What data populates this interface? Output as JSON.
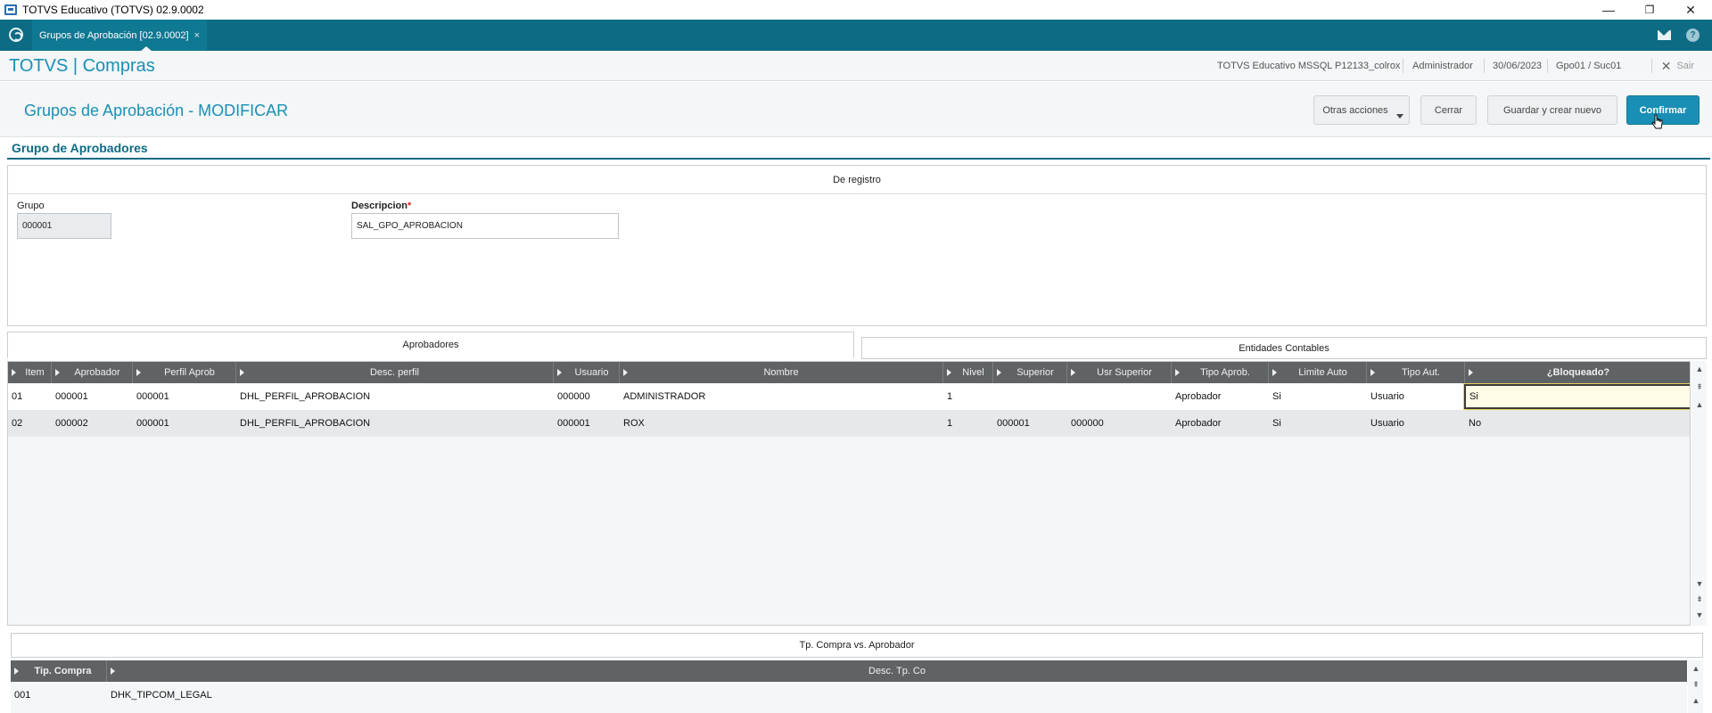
{
  "window": {
    "title": "TOTVS Educativo (TOTVS) 02.9.0002",
    "minimize": "—",
    "maximize": "❐",
    "close": "✕"
  },
  "tabbar": {
    "tab_label": "Grupos de Aprobación [02.9.0002]",
    "tab_close": "×"
  },
  "module": {
    "title": "TOTVS | Compras",
    "environment": "TOTVS Educativo MSSQL P12133_colrox",
    "user": "Administrador",
    "date": "30/06/2023",
    "branch": "Gpo01 / Suc01",
    "exit_label": "Sair"
  },
  "page": {
    "title": "Grupos de Aprobación - MODIFICAR",
    "buttons": {
      "more_actions": "Otras acciones",
      "close": "Cerrar",
      "save_new": "Guardar y crear nuevo",
      "confirm": "Confirmar"
    }
  },
  "section": {
    "title": "Grupo de Aprobadores"
  },
  "form": {
    "panel_title": "De registro",
    "grupo_label": "Grupo",
    "grupo_value": "000001",
    "descripcion_label": "Descripcion",
    "descripcion_required": "*",
    "descripcion_value": "SAL_GPO_APROBACION"
  },
  "tabs": {
    "aprobadores": "Aprobadores",
    "entidades": "Entidades Contables"
  },
  "grid": {
    "headers": [
      "Item",
      "Aprobador",
      "Perfil Aprob",
      "Desc. perfil",
      "Usuario",
      "Nombre",
      "Nivel",
      "Superior",
      "Usr Superior",
      "Tipo Aprob.",
      "Limite Auto",
      "Tipo Aut.",
      "¿Bloqueado?"
    ],
    "rows": [
      [
        "01",
        "000001",
        "000001",
        "DHL_PERFIL_APROBACION",
        "000000",
        "ADMINISTRADOR",
        "1",
        "",
        "",
        "Aprobador",
        "Si",
        "Usuario",
        "Si"
      ],
      [
        "02",
        "000002",
        "000001",
        "DHL_PERFIL_APROBACION",
        "000001",
        "ROX",
        "1",
        "000001",
        "000000",
        "Aprobador",
        "Si",
        "Usuario",
        "No"
      ]
    ]
  },
  "bottom": {
    "panel_title": "Tp. Compra vs. Aprobador",
    "headers": [
      "Tip. Compra",
      "Desc. Tp. Co"
    ],
    "rows": [
      [
        "001",
        "DHK_TIPCOM_LEGAL"
      ]
    ]
  },
  "colors": {
    "accent": "#1a8fb5",
    "tabbar": "#0d6b84",
    "grid_header": "#5f6366"
  }
}
